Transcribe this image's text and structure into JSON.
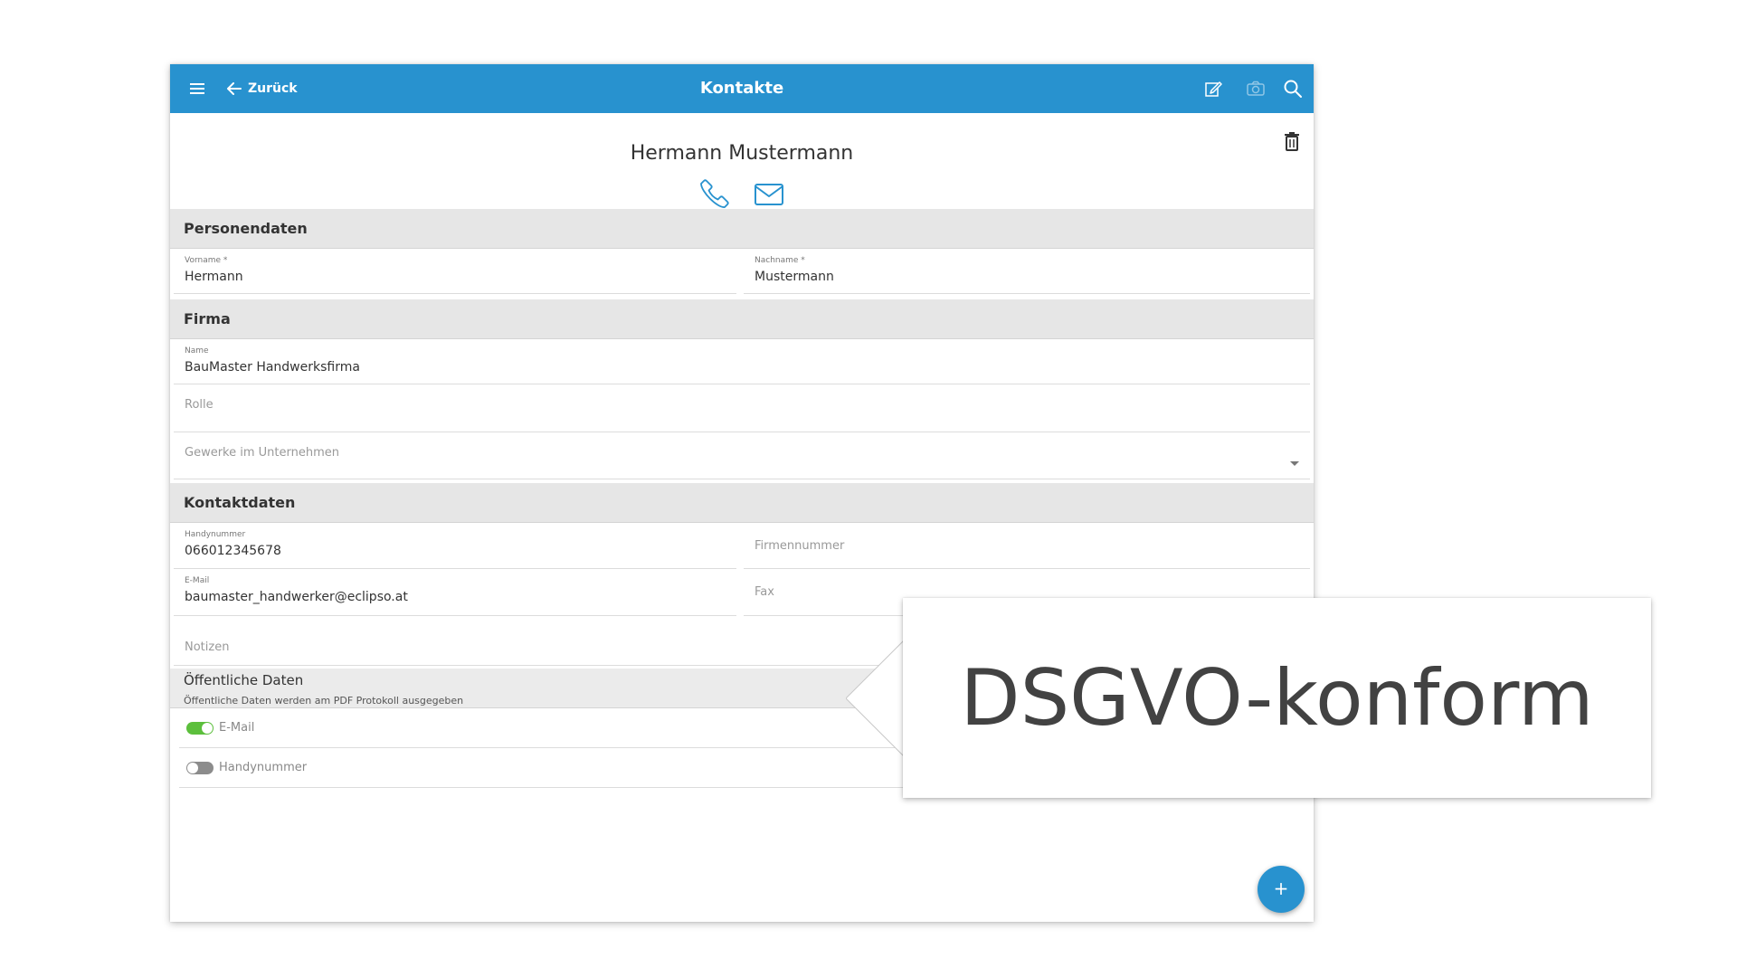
{
  "topbar": {
    "back_label": "Zurück",
    "title": "Kontakte",
    "color": "#2892cf"
  },
  "contact": {
    "full_name": "Hermann Mustermann"
  },
  "sections": {
    "person": "Personendaten",
    "company": "Firma",
    "contact": "Kontaktdaten",
    "public": "Öffentliche Daten",
    "public_sub": "Öffentliche Daten werden am PDF Protokoll ausgegeben"
  },
  "fields": {
    "firstname": {
      "label": "Vorname *",
      "value": "Hermann"
    },
    "lastname": {
      "label": "Nachname *",
      "value": "Mustermann"
    },
    "company_name": {
      "label": "Name",
      "value": "BauMaster Handwerksfirma"
    },
    "role": {
      "placeholder": "Rolle"
    },
    "trades": {
      "placeholder": "Gewerke im Unternehmen"
    },
    "mobile": {
      "label": "Handynummer",
      "value": "066012345678"
    },
    "company_phone": {
      "placeholder": "Firmennummer"
    },
    "email": {
      "label": "E-Mail",
      "value": "baumaster_handwerker@eclipso.at"
    },
    "fax": {
      "placeholder": "Fax"
    },
    "notes": {
      "placeholder": "Notizen"
    }
  },
  "toggles": [
    {
      "label": "E-Mail",
      "on": true
    },
    {
      "label": "Handynummer",
      "on": false
    }
  ],
  "fab": {
    "label": "+"
  },
  "callout": {
    "text": "DSGVO-konform"
  },
  "icons": [
    "menu-icon",
    "arrow-left-icon",
    "edit-icon",
    "camera-icon",
    "search-icon",
    "trash-icon",
    "phone-icon",
    "mail-icon",
    "plus-icon"
  ],
  "colors": {
    "accent": "#2892cf",
    "toggle_on": "#5cbf3c",
    "toggle_off": "#8c8c8c",
    "section_bg": "#e6e6e6"
  }
}
